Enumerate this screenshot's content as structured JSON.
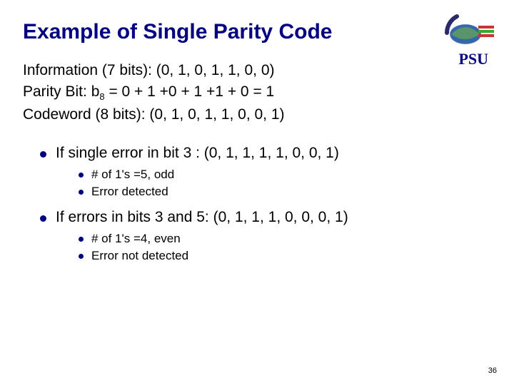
{
  "title": "Example of Single Parity Code",
  "brand": "PSU",
  "intro": {
    "line1": "Information (7 bits):  (0, 1, 0, 1, 1, 0, 0)",
    "line2_pre": "Parity Bit: b",
    "line2_sub": "8",
    "line2_post": " = 0 + 1 +0 + 1 +1 + 0 = 1",
    "line3": "Codeword (8 bits): (0, 1, 0, 1, 1, 0, 0, 1)"
  },
  "bullets": [
    {
      "text": "If single error in bit 3 : (0, 1, 1, 1, 1, 0, 0, 1)",
      "sub": [
        "# of 1's =5, odd",
        "Error detected"
      ]
    },
    {
      "text": "If errors in bits 3 and 5: (0, 1, 1, 1, 0, 0, 0, 1)",
      "sub": [
        "# of 1's =4, even",
        "Error not detected"
      ]
    }
  ],
  "page_number": "36"
}
